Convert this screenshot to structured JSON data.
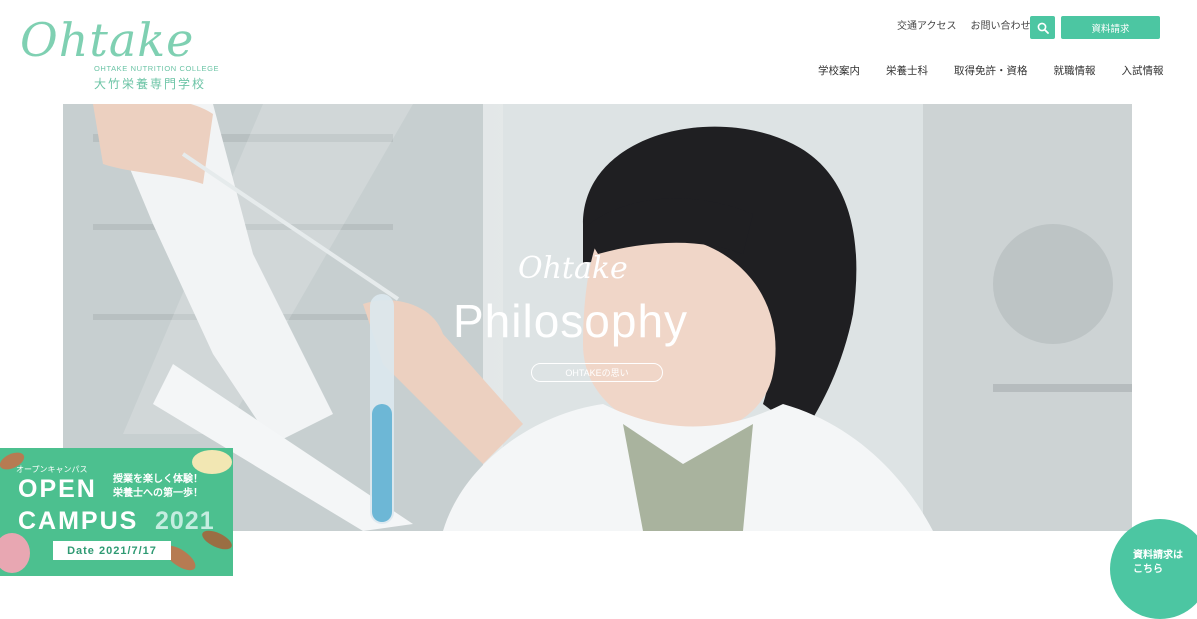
{
  "logo": {
    "script": "Ohtake",
    "english": "OHTAKE NUTRITION COLLEGE",
    "japanese": "大竹栄養専門学校"
  },
  "utility_nav": {
    "items": [
      "交通アクセス",
      "お問い合わせ"
    ]
  },
  "buttons": {
    "search_icon": "search-icon",
    "document_request": "資料請求"
  },
  "main_nav": {
    "items": [
      "学校案内",
      "栄養士科",
      "取得免許・資格",
      "就職情報",
      "入試情報"
    ]
  },
  "hero": {
    "script": "Ohtake",
    "title": "Philosophy",
    "button": "OHTAKEの思い"
  },
  "open_campus": {
    "small": "オープンキャンパス",
    "line1": "OPEN",
    "line2": "CAMPUS",
    "year": "2021",
    "copy_line1": "授業を楽しく体験！",
    "copy_line2": "栄養士への第一歩！",
    "date": "Date 2021/7/17"
  },
  "floating": {
    "line1": "資料請求は",
    "line2": "こちら"
  },
  "colors": {
    "accent": "#4cc6a2",
    "banner": "#4cc08f"
  }
}
